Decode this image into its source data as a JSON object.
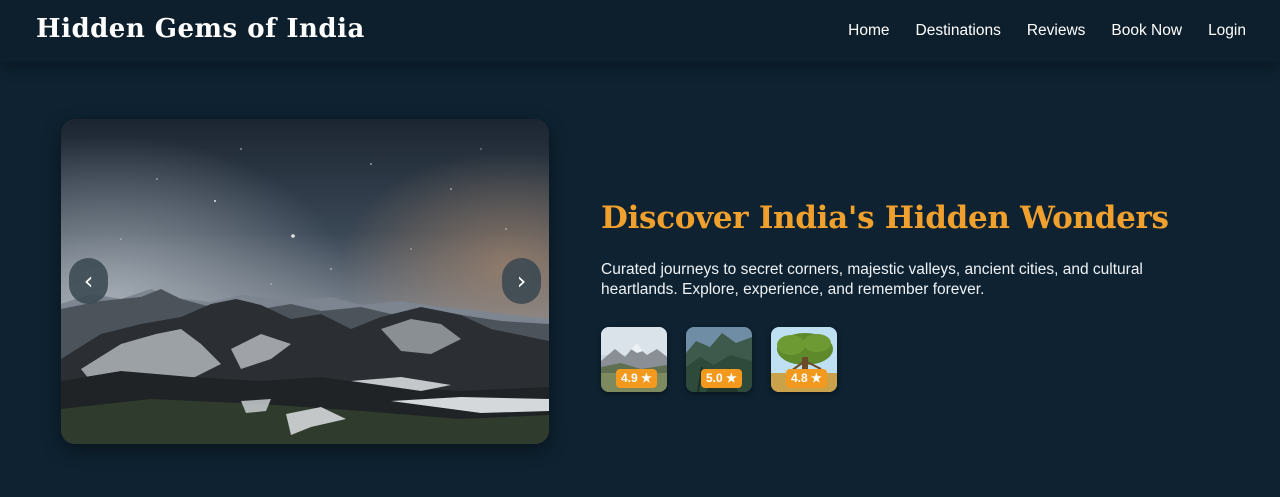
{
  "header": {
    "brand": "Hidden Gems of India",
    "nav": [
      {
        "label": "Home"
      },
      {
        "label": "Destinations"
      },
      {
        "label": "Reviews"
      },
      {
        "label": "Book Now"
      },
      {
        "label": "Login"
      }
    ]
  },
  "carousel": {
    "prev_icon": "‹",
    "next_icon": "›"
  },
  "hero": {
    "title": "Discover India's Hidden Wonders",
    "subtitle": "Curated journeys to secret corners, majestic valleys, ancient cities, and cultural heartlands. Explore, experience, and remember forever."
  },
  "thumbnails": [
    {
      "rating": "4.9 ★"
    },
    {
      "rating": "5.0 ★"
    },
    {
      "rating": "4.8 ★"
    }
  ],
  "colors": {
    "background": "#0e2231",
    "navbar": "#0d1f2c",
    "accent": "#f0a02c",
    "badge": "#f39a1e"
  }
}
